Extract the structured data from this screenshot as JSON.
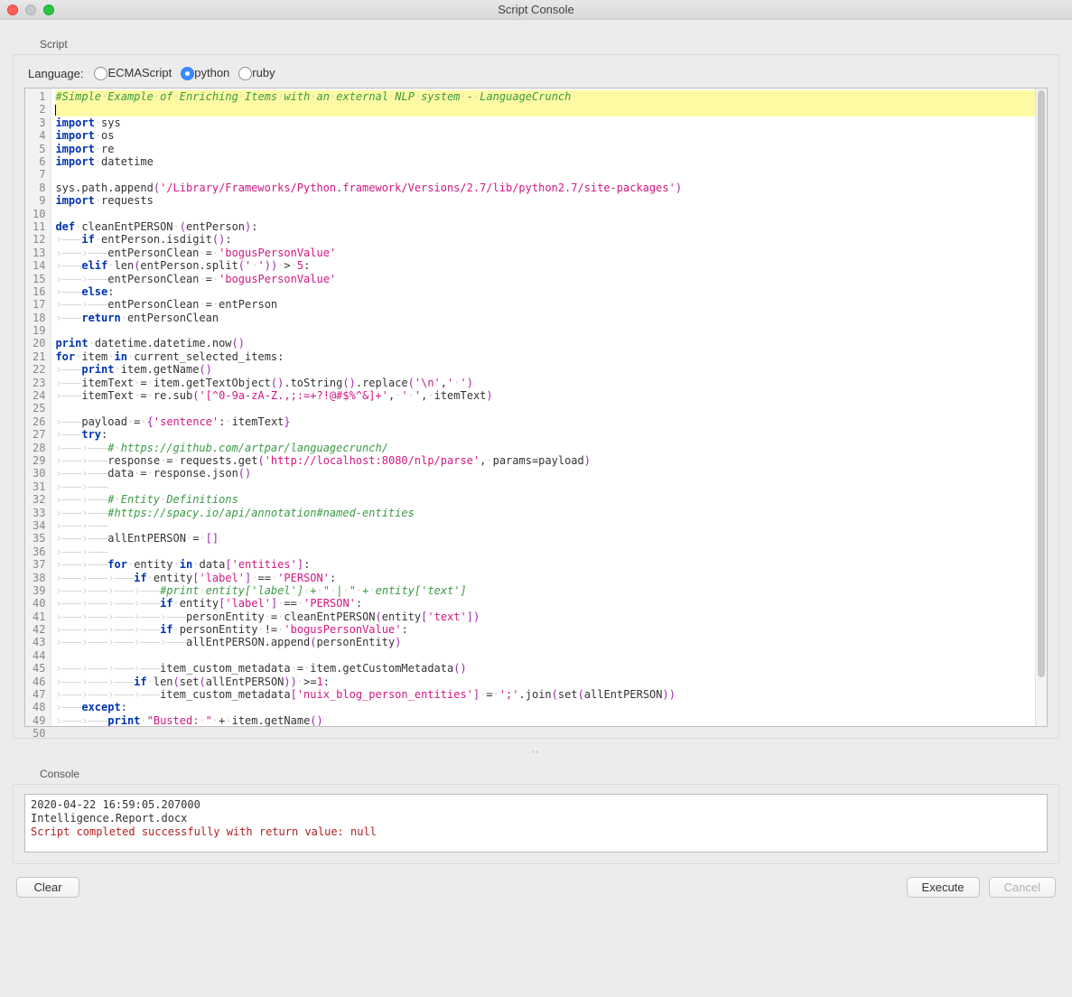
{
  "window": {
    "title": "Script Console"
  },
  "panels": {
    "script_label": "Script",
    "console_label": "Console"
  },
  "language": {
    "label": "Language:",
    "options": [
      {
        "label": "ECMAScript",
        "checked": false
      },
      {
        "label": "python",
        "checked": true
      },
      {
        "label": "ruby",
        "checked": false
      }
    ]
  },
  "buttons": {
    "clear": "Clear",
    "execute": "Execute",
    "cancel": "Cancel"
  },
  "code": {
    "lines": [
      {
        "n": 1,
        "highlight": true,
        "tokens": [
          [
            "com",
            "#Simple·Example·of·Enriching·Items·with·an·external·NLP·system·-·LanguageCrunch"
          ]
        ]
      },
      {
        "n": 2,
        "highlight": true,
        "tokens": [
          [
            "caret",
            ""
          ]
        ]
      },
      {
        "n": 3,
        "tokens": [
          [
            "kw",
            "import"
          ],
          [
            "",
            "·sys"
          ]
        ]
      },
      {
        "n": 4,
        "tokens": [
          [
            "kw",
            "import"
          ],
          [
            "",
            "·os"
          ]
        ]
      },
      {
        "n": 5,
        "tokens": [
          [
            "kw",
            "import"
          ],
          [
            "",
            "·re"
          ]
        ]
      },
      {
        "n": 6,
        "tokens": [
          [
            "kw",
            "import"
          ],
          [
            "",
            "·datetime"
          ]
        ]
      },
      {
        "n": 7,
        "tokens": []
      },
      {
        "n": 8,
        "tokens": [
          [
            "",
            "sys.path.append"
          ],
          [
            "par",
            "("
          ],
          [
            "str",
            "'/Library/Frameworks/Python.framework/Versions/2.7/lib/python2.7/site-packages'"
          ],
          [
            "par",
            ")"
          ]
        ]
      },
      {
        "n": 9,
        "tokens": [
          [
            "kw",
            "import"
          ],
          [
            "",
            "·requests"
          ]
        ]
      },
      {
        "n": 10,
        "tokens": []
      },
      {
        "n": 11,
        "tokens": [
          [
            "kw",
            "def"
          ],
          [
            "",
            "·cleanEntPERSON·"
          ],
          [
            "par",
            "("
          ],
          [
            "",
            "entPerson"
          ],
          [
            "par",
            ")"
          ],
          [
            ":",
            ":"
          ]
        ]
      },
      {
        "n": 12,
        "tokens": [
          [
            "ws",
            "⟶"
          ],
          [
            "kw",
            "if"
          ],
          [
            "",
            "·entPerson.isdigit"
          ],
          [
            "par",
            "()"
          ],
          [
            ":",
            ":"
          ]
        ]
      },
      {
        "n": 13,
        "tokens": [
          [
            "ws",
            "⟶⟶"
          ],
          [
            "",
            "entPersonClean·=·"
          ],
          [
            "str",
            "'bogusPersonValue'"
          ]
        ]
      },
      {
        "n": 14,
        "tokens": [
          [
            "ws",
            "⟶"
          ],
          [
            "kw",
            "elif"
          ],
          [
            "",
            "·len"
          ],
          [
            "par",
            "("
          ],
          [
            "",
            "entPerson.split"
          ],
          [
            "par",
            "("
          ],
          [
            "str",
            "'·'"
          ],
          [
            "par",
            "))"
          ],
          [
            "",
            "·>·"
          ],
          [
            "num",
            "5"
          ],
          [
            ":",
            ":"
          ]
        ]
      },
      {
        "n": 15,
        "tokens": [
          [
            "ws",
            "⟶⟶"
          ],
          [
            "",
            "entPersonClean·=·"
          ],
          [
            "str",
            "'bogusPersonValue'"
          ]
        ]
      },
      {
        "n": 16,
        "tokens": [
          [
            "ws",
            "⟶"
          ],
          [
            "kw",
            "else"
          ],
          [
            ":",
            ":"
          ]
        ]
      },
      {
        "n": 17,
        "tokens": [
          [
            "ws",
            "⟶⟶"
          ],
          [
            "",
            "entPersonClean·=·entPerson"
          ]
        ]
      },
      {
        "n": 18,
        "tokens": [
          [
            "ws",
            "⟶"
          ],
          [
            "kw",
            "return"
          ],
          [
            "",
            "·entPersonClean"
          ]
        ]
      },
      {
        "n": 19,
        "tokens": []
      },
      {
        "n": 20,
        "tokens": [
          [
            "kw",
            "print"
          ],
          [
            "",
            "·datetime.datetime.now"
          ],
          [
            "par",
            "()"
          ]
        ]
      },
      {
        "n": 21,
        "tokens": [
          [
            "kw",
            "for"
          ],
          [
            "",
            "·item·"
          ],
          [
            "kw",
            "in"
          ],
          [
            "",
            "·current_selected_items:"
          ]
        ]
      },
      {
        "n": 22,
        "tokens": [
          [
            "ws",
            "⟶"
          ],
          [
            "kw",
            "print"
          ],
          [
            "",
            "·item.getName"
          ],
          [
            "par",
            "()"
          ]
        ]
      },
      {
        "n": 23,
        "tokens": [
          [
            "ws",
            "⟶"
          ],
          [
            "",
            "itemText·=·item.getTextObject"
          ],
          [
            "par",
            "()"
          ],
          [
            "",
            ".toString"
          ],
          [
            "par",
            "()"
          ],
          [
            "",
            ".replace"
          ],
          [
            "par",
            "("
          ],
          [
            "str",
            "'\\n'"
          ],
          [
            "",
            ","
          ],
          [
            "str",
            "'·'"
          ],
          [
            "par",
            ")"
          ]
        ]
      },
      {
        "n": 24,
        "tokens": [
          [
            "ws",
            "⟶"
          ],
          [
            "",
            "itemText·=·re.sub"
          ],
          [
            "par",
            "("
          ],
          [
            "str",
            "'[^0-9a-zA-Z.,;:=+?!@#$%^&]+'"
          ],
          [
            "",
            ",·"
          ],
          [
            "str",
            "'·'"
          ],
          [
            "",
            ",·itemText"
          ],
          [
            "par",
            ")"
          ]
        ]
      },
      {
        "n": 25,
        "tokens": []
      },
      {
        "n": 26,
        "tokens": [
          [
            "ws",
            "⟶"
          ],
          [
            "",
            "payload·=·"
          ],
          [
            "par",
            "{"
          ],
          [
            "str",
            "'sentence'"
          ],
          [
            "",
            ":·itemText"
          ],
          [
            "par",
            "}"
          ]
        ]
      },
      {
        "n": 27,
        "tokens": [
          [
            "ws",
            "⟶"
          ],
          [
            "kw",
            "try"
          ],
          [
            ":",
            ":"
          ]
        ]
      },
      {
        "n": 28,
        "tokens": [
          [
            "ws",
            "⟶⟶"
          ],
          [
            "com",
            "#·https://github.com/artpar/languagecrunch/"
          ]
        ]
      },
      {
        "n": 29,
        "tokens": [
          [
            "ws",
            "⟶⟶"
          ],
          [
            "",
            "response·=·requests.get"
          ],
          [
            "par",
            "("
          ],
          [
            "str",
            "'http://localhost:8080/nlp/parse'"
          ],
          [
            "",
            ",·params=payload"
          ],
          [
            "par",
            ")"
          ]
        ]
      },
      {
        "n": 30,
        "tokens": [
          [
            "ws",
            "⟶⟶"
          ],
          [
            "",
            "data·=·response.json"
          ],
          [
            "par",
            "()"
          ]
        ]
      },
      {
        "n": 31,
        "tokens": [
          [
            "ws",
            "⟶⟶"
          ]
        ]
      },
      {
        "n": 32,
        "tokens": [
          [
            "ws",
            "⟶⟶"
          ],
          [
            "com",
            "#·Entity·Definitions"
          ]
        ]
      },
      {
        "n": 33,
        "tokens": [
          [
            "ws",
            "⟶⟶"
          ],
          [
            "com",
            "#https://spacy.io/api/annotation#named-entities"
          ]
        ]
      },
      {
        "n": 34,
        "tokens": [
          [
            "ws",
            "⟶⟶"
          ]
        ]
      },
      {
        "n": 35,
        "tokens": [
          [
            "ws",
            "⟶⟶"
          ],
          [
            "",
            "allEntPERSON·=·"
          ],
          [
            "par",
            "[]"
          ]
        ]
      },
      {
        "n": 36,
        "tokens": [
          [
            "ws",
            "⟶⟶"
          ]
        ]
      },
      {
        "n": 37,
        "tokens": [
          [
            "ws",
            "⟶⟶"
          ],
          [
            "kw",
            "for"
          ],
          [
            "",
            "·entity·"
          ],
          [
            "kw",
            "in"
          ],
          [
            "",
            "·data"
          ],
          [
            "par",
            "["
          ],
          [
            "str",
            "'entities'"
          ],
          [
            "par",
            "]"
          ],
          [
            ":",
            ":"
          ]
        ]
      },
      {
        "n": 38,
        "tokens": [
          [
            "ws",
            "⟶⟶⟶"
          ],
          [
            "kw",
            "if"
          ],
          [
            "",
            "·entity"
          ],
          [
            "par",
            "["
          ],
          [
            "str",
            "'label'"
          ],
          [
            "par",
            "]"
          ],
          [
            "",
            "·==·"
          ],
          [
            "str",
            "'PERSON'"
          ],
          [
            ":",
            ":"
          ]
        ]
      },
      {
        "n": 39,
        "tokens": [
          [
            "ws",
            "⟶⟶⟶⟶"
          ],
          [
            "com",
            "#print·entity['label']·+·\"·|·\"·+·entity['text']"
          ]
        ]
      },
      {
        "n": 40,
        "tokens": [
          [
            "ws",
            "⟶⟶⟶⟶"
          ],
          [
            "kw",
            "if"
          ],
          [
            "",
            "·entity"
          ],
          [
            "par",
            "["
          ],
          [
            "str",
            "'label'"
          ],
          [
            "par",
            "]"
          ],
          [
            "",
            "·==·"
          ],
          [
            "str",
            "'PERSON'"
          ],
          [
            ":",
            ":"
          ]
        ]
      },
      {
        "n": 41,
        "tokens": [
          [
            "ws",
            "⟶⟶⟶⟶⟶"
          ],
          [
            "",
            "personEntity·=·cleanEntPERSON"
          ],
          [
            "par",
            "("
          ],
          [
            "",
            "entity"
          ],
          [
            "par",
            "["
          ],
          [
            "str",
            "'text'"
          ],
          [
            "par",
            "])"
          ]
        ]
      },
      {
        "n": 42,
        "tokens": [
          [
            "ws",
            "⟶⟶⟶⟶"
          ],
          [
            "kw",
            "if"
          ],
          [
            "",
            "·personEntity·!=·"
          ],
          [
            "str",
            "'bogusPersonValue'"
          ],
          [
            ":",
            ":"
          ]
        ]
      },
      {
        "n": 43,
        "tokens": [
          [
            "ws",
            "⟶⟶⟶⟶⟶"
          ],
          [
            "",
            "allEntPERSON.append"
          ],
          [
            "par",
            "("
          ],
          [
            "",
            "personEntity"
          ],
          [
            "par",
            ")"
          ]
        ]
      },
      {
        "n": 44,
        "tokens": []
      },
      {
        "n": 45,
        "tokens": [
          [
            "ws",
            "⟶⟶⟶⟶"
          ],
          [
            "",
            "item_custom_metadata·=·item.getCustomMetadata"
          ],
          [
            "par",
            "()"
          ]
        ]
      },
      {
        "n": 46,
        "tokens": [
          [
            "ws",
            "⟶⟶⟶"
          ],
          [
            "kw",
            "if"
          ],
          [
            "",
            "·len"
          ],
          [
            "par",
            "("
          ],
          [
            "",
            "set"
          ],
          [
            "par",
            "("
          ],
          [
            "",
            "allEntPERSON"
          ],
          [
            "par",
            "))"
          ],
          [
            "",
            "·>="
          ],
          [
            "num",
            "1"
          ],
          [
            ":",
            ":"
          ]
        ]
      },
      {
        "n": 47,
        "tokens": [
          [
            "ws",
            "⟶⟶⟶⟶"
          ],
          [
            "",
            "item_custom_metadata"
          ],
          [
            "par",
            "["
          ],
          [
            "str",
            "'nuix_blog_person_entities'"
          ],
          [
            "par",
            "]"
          ],
          [
            "",
            "·=·"
          ],
          [
            "str",
            "';'"
          ],
          [
            "",
            ".join"
          ],
          [
            "par",
            "("
          ],
          [
            "",
            "set"
          ],
          [
            "par",
            "("
          ],
          [
            "",
            "allEntPERSON"
          ],
          [
            "par",
            "))"
          ]
        ]
      },
      {
        "n": 48,
        "tokens": [
          [
            "ws",
            "⟶"
          ],
          [
            "kw",
            "except"
          ],
          [
            ":",
            ":"
          ]
        ]
      },
      {
        "n": 49,
        "tokens": [
          [
            "ws",
            "⟶⟶"
          ],
          [
            "kw",
            "print"
          ],
          [
            "",
            "·"
          ],
          [
            "str",
            "\"Busted:·\""
          ],
          [
            "",
            "·+·item.getName"
          ],
          [
            "par",
            "()"
          ]
        ]
      },
      {
        "n": 50,
        "tokens": []
      }
    ]
  },
  "console": {
    "lines": [
      {
        "text": "2020-04-22 16:59:05.207000",
        "cls": ""
      },
      {
        "text": "Intelligence.Report.docx",
        "cls": ""
      },
      {
        "text": "Script completed successfully with return value: null",
        "cls": "success"
      }
    ]
  }
}
